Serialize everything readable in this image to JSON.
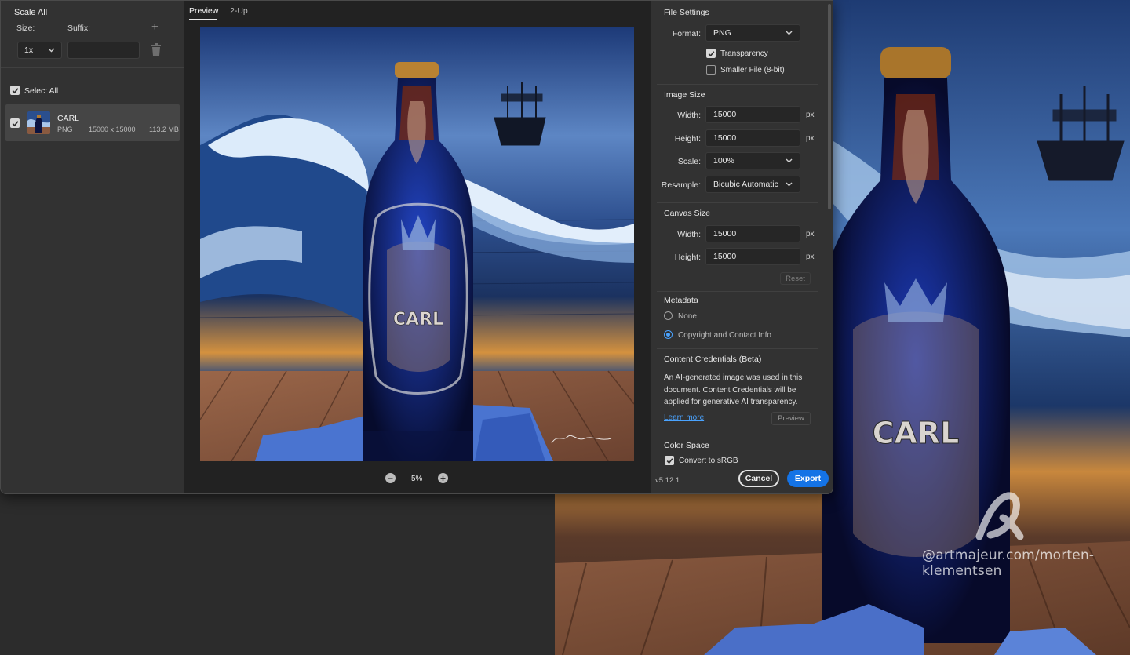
{
  "left_panel": {
    "title": "Scale All",
    "size_label": "Size:",
    "suffix_label": "Suffix:",
    "size_value": "1x",
    "suffix_value": "",
    "select_all_label": "Select All",
    "asset": {
      "name": "CARL",
      "format": "PNG",
      "dimensions": "15000 x 15000",
      "file_size": "113.2 MB"
    }
  },
  "preview_panel": {
    "tabs": [
      "Preview",
      "2-Up"
    ],
    "zoom": "5%",
    "image_text": "CARL"
  },
  "file_settings": {
    "title": "File Settings",
    "format_label": "Format:",
    "format_value": "PNG",
    "transparency_label": "Transparency",
    "smaller_file_label": "Smaller File (8-bit)"
  },
  "image_size": {
    "title": "Image Size",
    "width_label": "Width:",
    "width_value": "15000",
    "height_label": "Height:",
    "height_value": "15000",
    "scale_label": "Scale:",
    "scale_value": "100%",
    "resample_label": "Resample:",
    "resample_value": "Bicubic Automatic",
    "unit": "px"
  },
  "canvas_size": {
    "title": "Canvas Size",
    "width_label": "Width:",
    "width_value": "15000",
    "height_label": "Height:",
    "height_value": "15000",
    "unit": "px",
    "reset_label": "Reset"
  },
  "metadata": {
    "title": "Metadata",
    "option_none": "None",
    "option_copyright": "Copyright and Contact Info"
  },
  "content_credentials": {
    "title": "Content Credentials (Beta)",
    "description": "An AI-generated image was used in this document. Content Credentials will be applied for generative AI transparency.",
    "learn_more": "Learn more",
    "preview_label": "Preview"
  },
  "color_space": {
    "title": "Color Space",
    "convert_label": "Convert to sRGB"
  },
  "footer": {
    "version": "v5.12.1",
    "cancel_label": "Cancel",
    "export_label": "Export"
  },
  "background": {
    "bottle_text": "CARL",
    "watermark": "@artmajeur.com/morten-klementsen"
  },
  "colors": {
    "accent": "#1473e6",
    "link": "#4aa3ff"
  }
}
